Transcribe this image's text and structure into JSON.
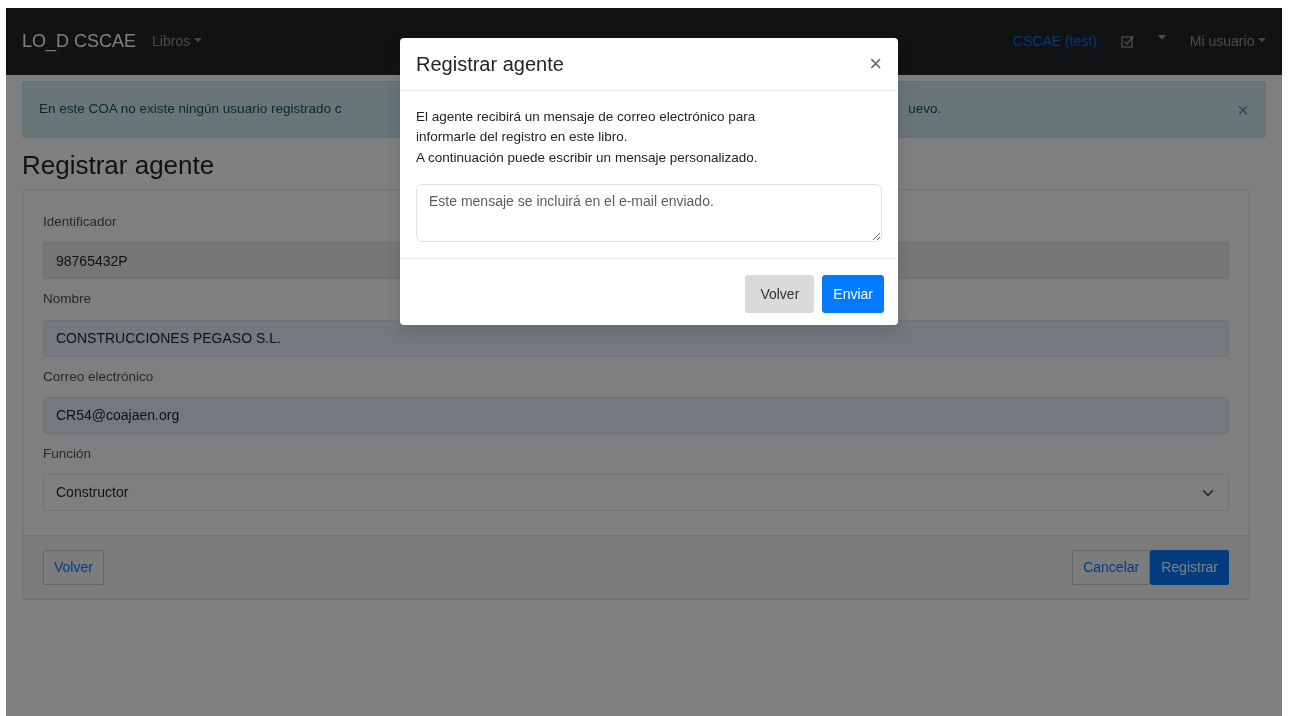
{
  "navbar": {
    "brand": "LO_D CSCAE",
    "menu": [
      {
        "label": "Libros"
      }
    ],
    "env_link": "CSCAE (test)",
    "user_menu": "Mi usuario"
  },
  "alert": {
    "text_start": "En este COA no existe ningún usuario registrado c",
    "text_end": "uevo.",
    "close": "×"
  },
  "page_title": "Registrar agente",
  "form": {
    "fields": [
      {
        "kind": "readonly",
        "label": "Identificador",
        "value": "98765432P"
      },
      {
        "kind": "autofilled",
        "label": "Nombre",
        "value": "CONSTRUCCIONES PEGASO S.L."
      },
      {
        "kind": "autofilled",
        "label": "Correo electrónico",
        "value": "CR54@coajaen.org"
      },
      {
        "kind": "select",
        "label": "Función",
        "value": "Constructor"
      }
    ],
    "footer_left": [
      {
        "label": "Volver"
      }
    ],
    "footer_right": [
      {
        "label": "Cancelar"
      },
      {
        "label": "Registrar"
      }
    ]
  },
  "modal": {
    "title": "Registrar agente",
    "close": "×",
    "paragraphs": [
      "El agente recibirá un mensaje de correo electrónico para informarle del registro en este libro.",
      "A continuación puede escribir un mensaje personalizado."
    ],
    "message": {
      "placeholder": "Este mensaje se incluirá en el e-mail enviado."
    },
    "buttons": [
      {
        "label": "Volver"
      },
      {
        "label": "Enviar"
      }
    ]
  }
}
